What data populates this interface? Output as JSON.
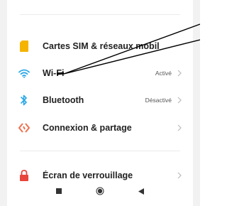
{
  "settings": {
    "items": [
      {
        "label": "Cartes SIM & réseaux mobil",
        "status": "",
        "icon": "sim-card-icon"
      },
      {
        "label": "Wi-Fi",
        "status": "Activé",
        "icon": "wifi-icon"
      },
      {
        "label": "Bluetooth",
        "status": "Désactivé",
        "icon": "bluetooth-icon"
      },
      {
        "label": "Connexion & partage",
        "status": "",
        "icon": "share-connection-icon"
      },
      {
        "label": "Écran de verrouillage",
        "status": "",
        "icon": "lock-icon"
      }
    ]
  },
  "navbar": {
    "buttons": [
      "recent-apps",
      "home",
      "back"
    ]
  },
  "colors": {
    "sim": "#f5b400",
    "wifi": "#2aa7e6",
    "bluetooth": "#2aa7e6",
    "share": "#f07050",
    "lock": "#e8453c"
  }
}
